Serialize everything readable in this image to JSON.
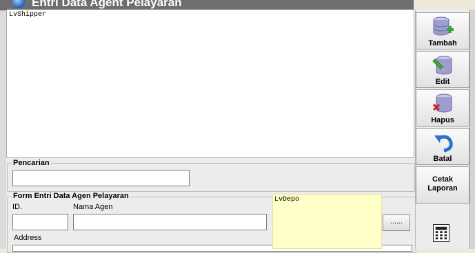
{
  "window": {
    "title": "Entri Data Agent Pelayaran"
  },
  "list_shipper": {
    "label": "LvShipper"
  },
  "search": {
    "group_label": "Pencarian",
    "value": ""
  },
  "form": {
    "group_label": "Form Entri Data Agen Pelayaran",
    "id_label": "ID.",
    "id_value": "",
    "nama_label": "Nama Agen",
    "nama_value": "",
    "address_label": "Address",
    "browse_label": "......"
  },
  "list_depo": {
    "label": "LvDepo"
  },
  "sidebar": {
    "tambah": "Tambah",
    "edit": "Edit",
    "hapus": "Hapus",
    "batal": "Batal",
    "cetak_line1": "Cetak",
    "cetak_line2": "Laporan"
  },
  "icons": [
    "database-add-icon",
    "database-edit-icon",
    "database-delete-icon",
    "undo-icon",
    "calculator-icon"
  ]
}
